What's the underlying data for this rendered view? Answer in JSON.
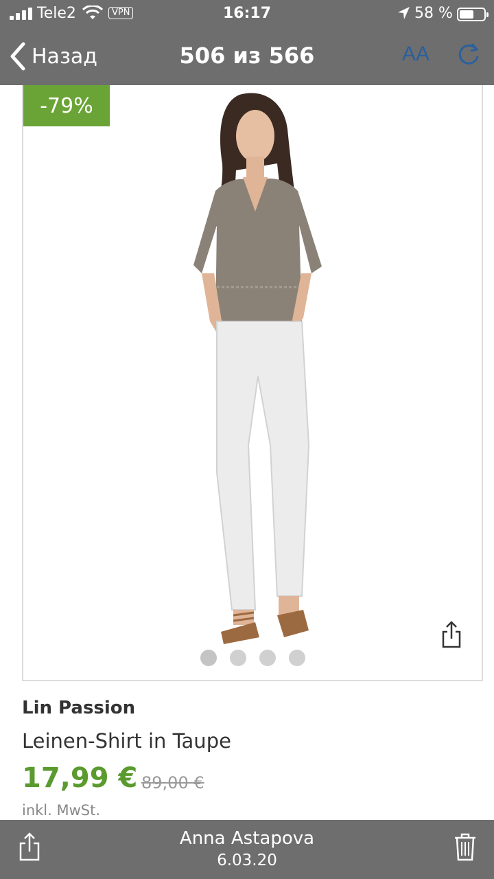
{
  "status_bar": {
    "carrier": "Tele2",
    "vpn": "VPN",
    "time": "16:17",
    "battery_pct": "58 %",
    "battery_level": 0.58
  },
  "nav": {
    "back_label": "Назад",
    "title": "506 из 566",
    "text_size_label": "AA"
  },
  "product": {
    "discount_badge": "-79%",
    "brand": "Lin Passion",
    "name": "Leinen-Shirt in Taupe",
    "price": "17,99 €",
    "old_price": "89,00 €",
    "tax_note": "inkl. MwSt.",
    "image_dots": 4,
    "active_dot": 0
  },
  "footer": {
    "author": "Anna Astapova",
    "date": "6.03.20"
  },
  "colors": {
    "accent_green": "#6aa436",
    "price_green": "#5a9a2e",
    "ios_blue": "#2b5f9e",
    "overlay_gray": "#6e6e6e"
  }
}
